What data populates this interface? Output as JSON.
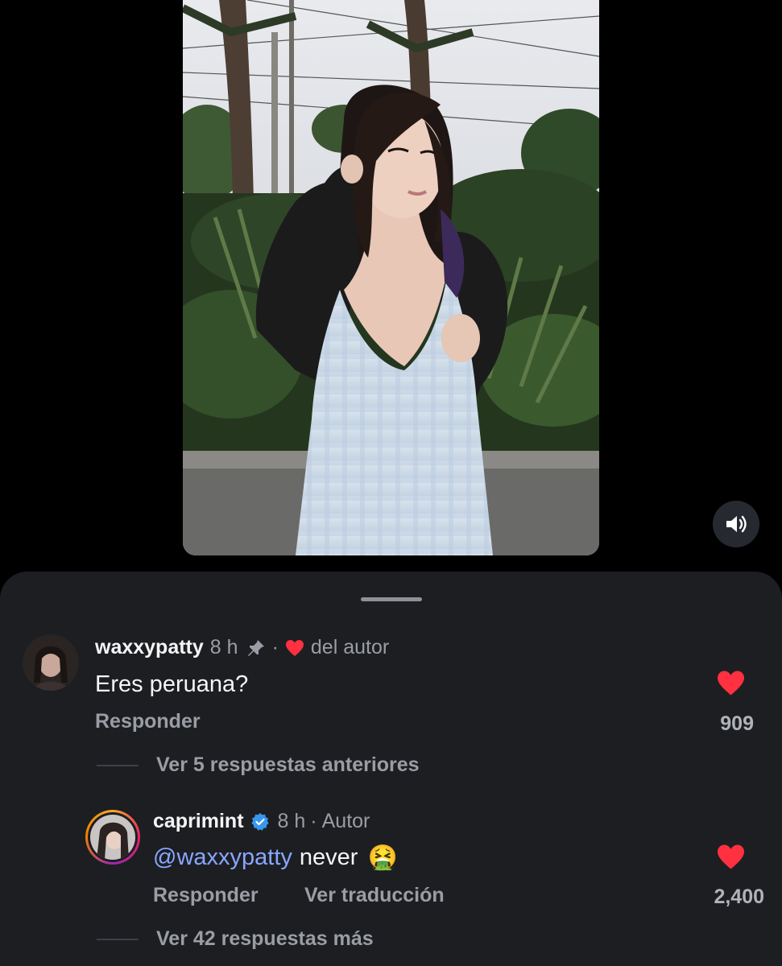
{
  "post": {
    "mute_icon": "speaker-icon"
  },
  "comments": [
    {
      "username": "waxxypatty",
      "time": "8 h",
      "pinned_icon": "pin-icon",
      "separator": "·",
      "author_like_label": "del autor",
      "text": "Eres peruana?",
      "reply_label": "Responder",
      "like_count": "909",
      "replies_label": "Ver 5 respuestas anteriores"
    },
    {
      "username": "caprimint",
      "verified_icon": "verified-badge-icon",
      "time": "8 h",
      "separator": "·",
      "author_label": "Autor",
      "mention": "@waxxypatty",
      "text": "never",
      "emoji": "🤮",
      "reply_label": "Responder",
      "translate_label": "Ver traducción",
      "like_count": "2,400",
      "replies_label": "Ver 42 respuestas más"
    }
  ],
  "colors": {
    "background": "#000000",
    "sheet": "#1c1e22",
    "like_red": "#ff3040",
    "mention_blue": "#8aa6ff",
    "verified_blue": "#3897f0"
  }
}
